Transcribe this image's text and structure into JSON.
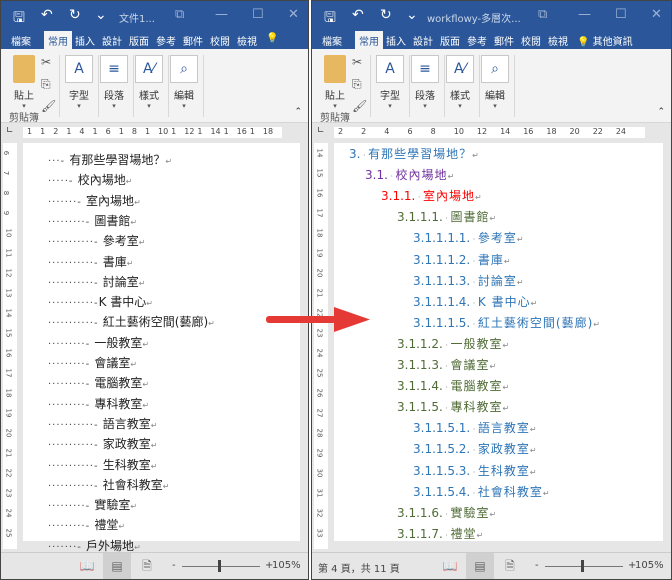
{
  "quick_access": {
    "save_icon": "save-icon",
    "undo_icon": "undo-icon",
    "redo_icon": "redo-icon",
    "customize_icon": "customize-icon"
  },
  "tabs": [
    "檔案",
    "常用",
    "插入",
    "設計",
    "版面",
    "參考",
    "郵件",
    "校閱",
    "檢視"
  ],
  "ribbon": {
    "paste": "貼上",
    "clipboard": "剪貼簿",
    "font": "字型",
    "paragraph": "段落",
    "styles": "樣式",
    "editing": "編輯"
  },
  "left": {
    "title": "文件1...",
    "tell_me": "",
    "ruler_labels": [
      "1",
      "1",
      "2",
      "1",
      "4",
      "1",
      "6",
      "1",
      "8",
      "1",
      "10",
      "1",
      "12",
      "1",
      "14",
      "1",
      "16",
      "1",
      "18"
    ],
    "vruler": [
      "6",
      "7",
      "8",
      "9",
      "10",
      "11",
      "12",
      "13",
      "14",
      "15",
      "16",
      "17",
      "18",
      "19",
      "20",
      "21",
      "22",
      "23",
      "24",
      "25"
    ],
    "lines": [
      {
        "level": 1,
        "text": "有那些學習場地？"
      },
      {
        "level": 2,
        "text": "校內場地"
      },
      {
        "level": 3,
        "text": "室內場地"
      },
      {
        "level": 4,
        "text": "圖書館"
      },
      {
        "level": 5,
        "text": "參考室"
      },
      {
        "level": 5,
        "text": "書庫"
      },
      {
        "level": 5,
        "text": "討論室"
      },
      {
        "level": 5,
        "text": "K 書中心"
      },
      {
        "level": 5,
        "text": "紅土藝術空間(藝廊)"
      },
      {
        "level": 4,
        "text": "一般教室"
      },
      {
        "level": 4,
        "text": "會議室"
      },
      {
        "level": 4,
        "text": "電腦教室"
      },
      {
        "level": 4,
        "text": "專科教室"
      },
      {
        "level": 5,
        "text": "語言教室"
      },
      {
        "level": 5,
        "text": "家政教室"
      },
      {
        "level": 5,
        "text": "生科教室"
      },
      {
        "level": 5,
        "text": "社會科教室"
      },
      {
        "level": 4,
        "text": "實驗室"
      },
      {
        "level": 4,
        "text": "禮堂"
      },
      {
        "level": 3,
        "text": "戶外場地"
      }
    ],
    "status": {
      "page": "",
      "zoom": "105%"
    }
  },
  "right": {
    "title": "workflowy-多層次...",
    "tell_me": "其他資訊",
    "ruler_labels": [
      "2",
      "2",
      "4",
      "6",
      "8",
      "10",
      "12",
      "14",
      "16",
      "18",
      "20",
      "22",
      "24"
    ],
    "vruler": [
      "14",
      "15",
      "16",
      "17",
      "18",
      "19",
      "20",
      "21",
      "22",
      "23",
      "24",
      "25",
      "26",
      "27",
      "28",
      "29",
      "30",
      "31",
      "32",
      "33"
    ],
    "lines": [
      {
        "level": 1,
        "num": "3.",
        "text": "有那些學習場地？"
      },
      {
        "level": 2,
        "num": "3.1.",
        "text": "校內場地"
      },
      {
        "level": 3,
        "num": "3.1.1.",
        "text": "室內場地"
      },
      {
        "level": 4,
        "num": "3.1.1.1.",
        "text": "圖書館"
      },
      {
        "level": 5,
        "num": "3.1.1.1.1.",
        "text": "參考室"
      },
      {
        "level": 5,
        "num": "3.1.1.1.2.",
        "text": "書庫"
      },
      {
        "level": 5,
        "num": "3.1.1.1.3.",
        "text": "討論室"
      },
      {
        "level": 5,
        "num": "3.1.1.1.4.",
        "text": "K 書中心"
      },
      {
        "level": 5,
        "num": "3.1.1.1.5.",
        "text": "紅土藝術空間(藝廊)"
      },
      {
        "level": 4,
        "num": "3.1.1.2.",
        "text": "一般教室"
      },
      {
        "level": 4,
        "num": "3.1.1.3.",
        "text": "會議室"
      },
      {
        "level": 4,
        "num": "3.1.1.4.",
        "text": "電腦教室"
      },
      {
        "level": 4,
        "num": "3.1.1.5.",
        "text": "專科教室"
      },
      {
        "level": 5,
        "num": "3.1.1.5.1.",
        "text": "語言教室"
      },
      {
        "level": 5,
        "num": "3.1.1.5.2.",
        "text": "家政教室"
      },
      {
        "level": 5,
        "num": "3.1.1.5.3.",
        "text": "生科教室"
      },
      {
        "level": 5,
        "num": "3.1.1.5.4.",
        "text": "社會科教室"
      },
      {
        "level": 4,
        "num": "3.1.1.6.",
        "text": "實驗室"
      },
      {
        "level": 4,
        "num": "3.1.1.7.",
        "text": "禮堂"
      }
    ],
    "status": {
      "page": "第 4 頁，共 11 頁",
      "zoom": "105%"
    }
  },
  "level_colors": {
    "1": "#2e75b6",
    "2": "#7030a0",
    "3": "#ff0000",
    "4": "#4f6b35",
    "5": "#2e75b6"
  },
  "arrow_color": "#e53935"
}
